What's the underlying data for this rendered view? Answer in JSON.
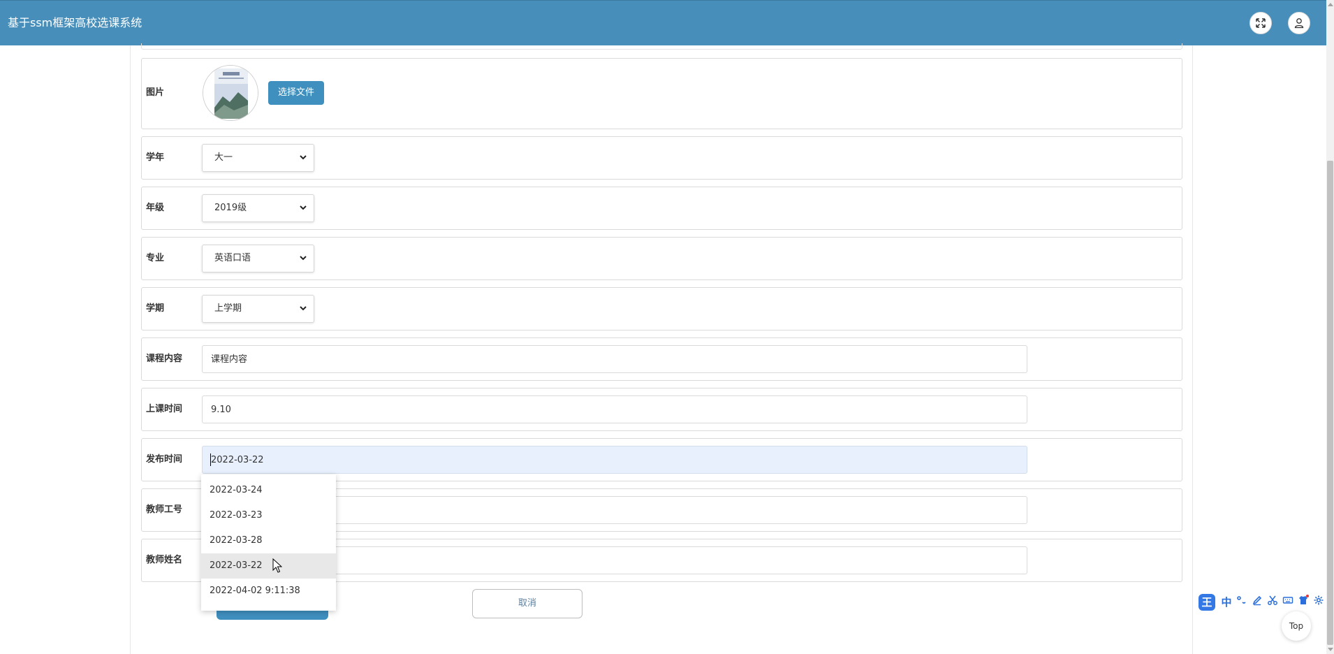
{
  "app": {
    "title": "基于ssm框架高校选课系统"
  },
  "header": {
    "fullscreen_icon": "expand-arrows-icon",
    "user_icon": "user-profile-icon"
  },
  "form": {
    "image": {
      "label": "图片",
      "choose_file_label": "选择文件"
    },
    "academic_year": {
      "label": "学年",
      "value": "大一"
    },
    "grade": {
      "label": "年级",
      "value": "2019级"
    },
    "major": {
      "label": "专业",
      "value": "英语口语"
    },
    "semester": {
      "label": "学期",
      "value": "上学期"
    },
    "course_content": {
      "label": "课程内容",
      "value": "课程内容"
    },
    "class_time": {
      "label": "上课时间",
      "value": "9.10"
    },
    "publish_time": {
      "label": "发布时间",
      "value": "2022-03-22"
    },
    "teacher_id": {
      "label": "教师工号",
      "value": ""
    },
    "teacher_name": {
      "label": "教师姓名",
      "value": ""
    },
    "cancel_label": "取消"
  },
  "autocomplete": {
    "options": [
      "2022-03-24",
      "2022-03-23",
      "2022-03-28",
      "2022-03-22",
      "2022-04-02 9:11:38"
    ],
    "highlighted": "2022-03-22"
  },
  "ime_toolbar": {
    "logo": "王",
    "mode": "中",
    "items": [
      "punctuation-icon",
      "pen-icon",
      "scissors-icon",
      "keyboard-icon",
      "skin-icon",
      "settings-icon"
    ]
  },
  "back_to_top": {
    "label": "Top"
  },
  "colors": {
    "header_bg": "#478fba",
    "primary_button": "#3f8fbf",
    "focused_input_bg": "#e8f0fe"
  }
}
